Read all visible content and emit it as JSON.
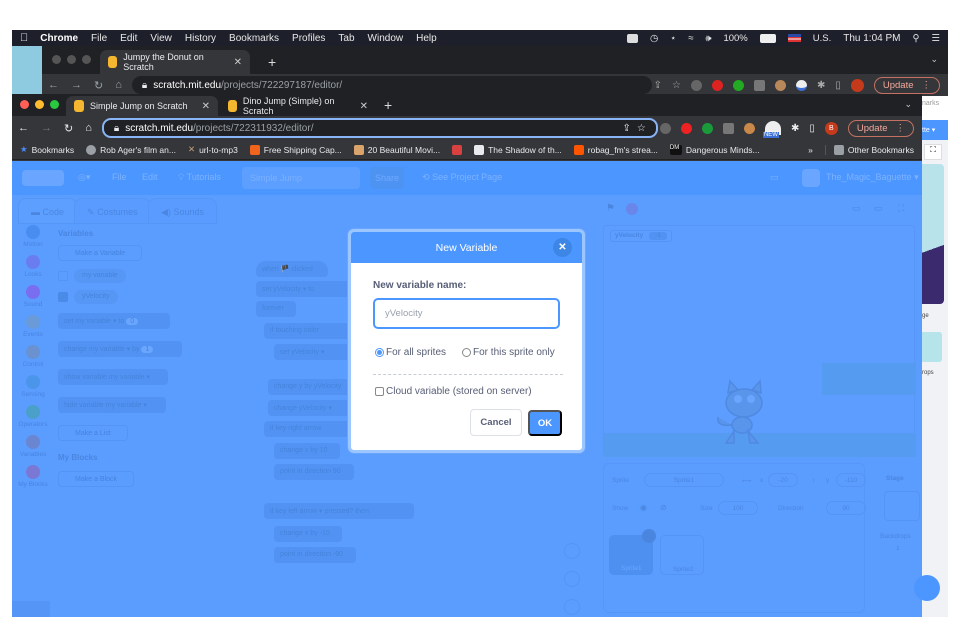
{
  "menubar": {
    "app": "Chrome",
    "items": [
      "File",
      "Edit",
      "View",
      "History",
      "Bookmarks",
      "Profiles",
      "Tab",
      "Window",
      "Help"
    ],
    "battery": "100%",
    "input_source": "U.S.",
    "clock": "Thu 1:04 PM"
  },
  "back_window": {
    "tab_title": "Jumpy the Donut on Scratch",
    "url_host": "scratch.mit.edu",
    "url_path": "/projects/722297187/editor/",
    "update_label": "Update"
  },
  "front_window": {
    "tabs": [
      {
        "title": "Simple Jump on Scratch",
        "active": true
      },
      {
        "title": "Dino Jump (Simple) on Scratch",
        "active": false
      }
    ],
    "url_host": "scratch.mit.edu",
    "url_path": "/projects/722311932/editor/",
    "update_label": "Update",
    "profile_initial": "B",
    "ext_new_badge": "NEW",
    "bookmarks": [
      {
        "label": "Bookmarks",
        "icon": "star-icon",
        "color": "#4c8bf5"
      },
      {
        "label": "Rob Ager's film an...",
        "icon": "globe-icon",
        "color": "#9aa0a6"
      },
      {
        "label": "url-to-mp3",
        "icon": "cross-icon",
        "color": "#c4a17a"
      },
      {
        "label": "Free Shipping Cap...",
        "icon": "etsy-icon",
        "color": "#f1641e"
      },
      {
        "label": "20 Beautiful Movi...",
        "icon": "grid-icon",
        "color": "#d9a36b"
      },
      {
        "label": "",
        "icon": "cartoon-icon",
        "color": "#d94141"
      },
      {
        "label": "The Shadow of th...",
        "icon": "wikipedia-icon",
        "color": "#e8eaed"
      },
      {
        "label": "robag_fm's strea...",
        "icon": "soundcloud-icon",
        "color": "#ff5500"
      },
      {
        "label": "Dangerous Minds...",
        "icon": "dm-icon",
        "color": "#111111"
      }
    ],
    "overflow": "»",
    "other_bookmarks": "Other Bookmarks"
  },
  "scratch": {
    "menu": {
      "file": "File",
      "edit": "Edit",
      "tutorials": "Tutorials",
      "project_title": "Simple Jump",
      "share": "Share",
      "see_project": "See Project Page",
      "username": "The_Magic_Baguette"
    },
    "tabs": [
      "Code",
      "Costumes",
      "Sounds"
    ],
    "categories": [
      {
        "label": "Motion",
        "color": "#4a8df0"
      },
      {
        "label": "Looks",
        "color": "#6a7df0"
      },
      {
        "label": "Sound",
        "color": "#7a6ef0"
      },
      {
        "label": "Events",
        "color": "#6a9ad8"
      },
      {
        "label": "Control",
        "color": "#6a92d0"
      },
      {
        "label": "Sensing",
        "color": "#4b95ea"
      },
      {
        "label": "Operators",
        "color": "#4aa0c8"
      },
      {
        "label": "Variables",
        "color": "#6a86d0"
      },
      {
        "label": "My Blocks",
        "color": "#7a78d4"
      }
    ],
    "palette": {
      "heading": "Variables",
      "make_variable": "Make a Variable",
      "variables": [
        {
          "name": "my variable",
          "checked": false
        },
        {
          "name": "yVelocity",
          "checked": true
        }
      ],
      "blocks": [
        {
          "text": "set  my variable ▾  to",
          "value": "0"
        },
        {
          "text": "change  my variable ▾  by",
          "value": "1"
        },
        {
          "text": "show variable  my variable ▾",
          "value": null
        },
        {
          "text": "hide variable  my variable ▾",
          "value": null
        }
      ],
      "make_list": "Make a List",
      "my_blocks_heading": "My Blocks",
      "make_block": "Make a Block"
    },
    "script": [
      "when 🏴 clicked",
      "set  yVelocity ▾  to",
      "forever",
      "if   touching color",
      "set  yVelocity ▾",
      "change y by  yVelocity",
      "change  yVelocity ▾",
      "if   key  right arrow",
      "change x by  10",
      "point in direction  90",
      "if   key  left arrow ▾  pressed?  then",
      "change x by  -10",
      "point in direction  -90"
    ],
    "monitor": {
      "name": "yVelocity",
      "value": "-1"
    },
    "sprite_info": {
      "sprite_label": "Sprite",
      "sprite_name": "Sprite1",
      "x_label": "x",
      "x": "-20",
      "y_label": "y",
      "y": "-110",
      "show_label": "Show",
      "size_label": "Size",
      "size": "100",
      "direction_label": "Direction",
      "direction": "90"
    },
    "sprites": [
      "Sprite1",
      "Sprite2"
    ],
    "stage_panel": {
      "label": "Stage",
      "backdrops_label": "Backdrops",
      "backdrops_count": "1"
    }
  },
  "dialog": {
    "title": "New Variable",
    "prompt": "New variable name:",
    "input_value": "yVelocity",
    "scope_options": [
      {
        "label": "For all sprites",
        "selected": true
      },
      {
        "label": "For this sprite only",
        "selected": false
      }
    ],
    "cloud_label": "Cloud variable (stored on server)",
    "cloud_checked": false,
    "cancel": "Cancel",
    "ok": "OK"
  },
  "peek_window": {
    "labels": [
      "narks",
      "tte ▾",
      "ge",
      "rops"
    ]
  }
}
